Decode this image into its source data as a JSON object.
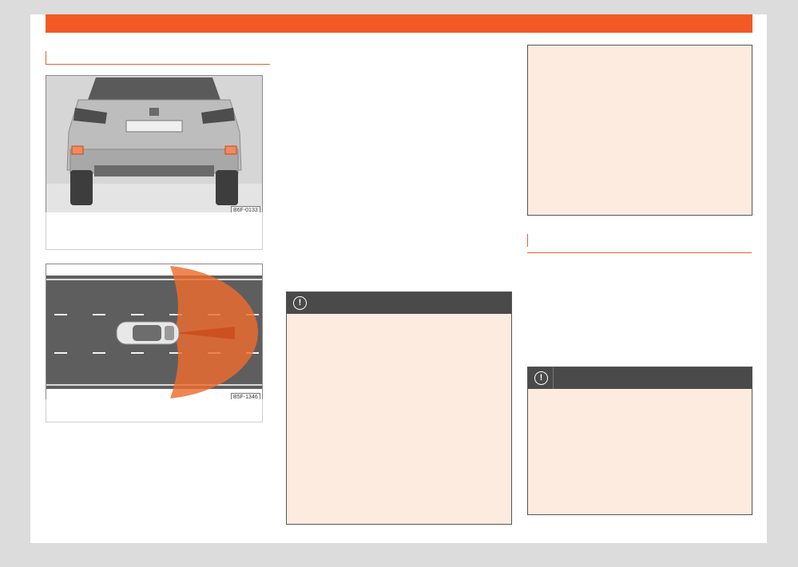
{
  "figures": [
    {
      "code": "B6F-0133",
      "caption": ""
    },
    {
      "code": "B5F-1346",
      "caption": ""
    }
  ],
  "warnings": [
    {
      "icon": "!"
    },
    {
      "icon": "!"
    }
  ],
  "colors": {
    "accent": "#f15a24",
    "warning_bg": "#fdebdf",
    "warning_header": "#4a4a4a",
    "note_border": "#555555"
  }
}
